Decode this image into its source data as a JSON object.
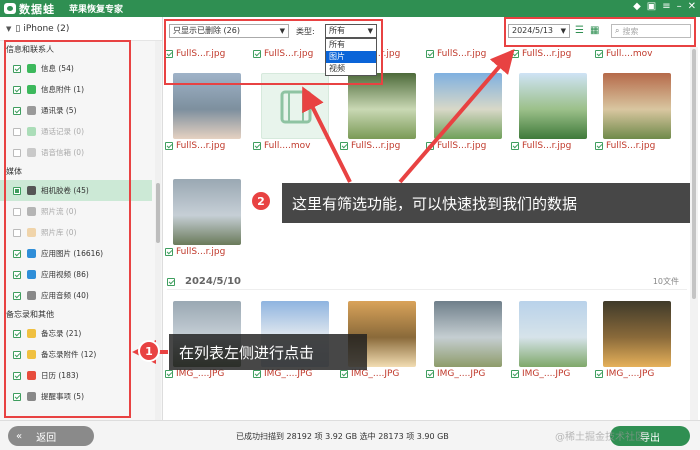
{
  "titlebar": {
    "logo_text": "数据蛙",
    "product_name": "苹果恢复专家"
  },
  "device": {
    "name": "iPhone (2)"
  },
  "sidebar": {
    "sections": [
      {
        "title": "信息和联系人",
        "items": [
          {
            "label": "信息 (54)",
            "state": "checked",
            "color": "#3cb85c"
          },
          {
            "label": "信息附件 (1)",
            "state": "checked",
            "color": "#3cb85c"
          },
          {
            "label": "通讯录 (5)",
            "state": "checked",
            "color": "#9a9a9a"
          },
          {
            "label": "通话记录 (0)",
            "state": "empty",
            "color": "#3cb85c"
          },
          {
            "label": "语音信箱 (0)",
            "state": "empty",
            "color": "#888888"
          }
        ]
      },
      {
        "title": "媒体",
        "items": [
          {
            "label": "相机胶卷 (45)",
            "state": "partial",
            "color": "#555555",
            "selected": true
          },
          {
            "label": "照片流 (0)",
            "state": "empty",
            "color": "#555555"
          },
          {
            "label": "照片库 (0)",
            "state": "empty",
            "color": "#e9a33a"
          },
          {
            "label": "应用图片 (16616)",
            "state": "checked",
            "color": "#2f8ed8"
          },
          {
            "label": "应用视频 (86)",
            "state": "checked",
            "color": "#2f8ed8"
          },
          {
            "label": "应用音频 (40)",
            "state": "checked",
            "color": "#888888"
          }
        ]
      },
      {
        "title": "备忘录和其他",
        "items": [
          {
            "label": "备忘录 (21)",
            "state": "checked",
            "color": "#f0c040"
          },
          {
            "label": "备忘录附件 (12)",
            "state": "checked",
            "color": "#f0c040"
          },
          {
            "label": "日历 (183)",
            "state": "checked",
            "color": "#e74c3c"
          },
          {
            "label": "提醒事项 (5)",
            "state": "checked",
            "color": "#888888"
          }
        ]
      }
    ]
  },
  "toolbar": {
    "filter_value": "只显示已删除 (26)",
    "type_label": "类型:",
    "type_value": "所有",
    "type_options": [
      "所有",
      "图片",
      "视频"
    ],
    "type_selected_index": 1,
    "date_value": "2024/5/13",
    "search_placeholder": "搜索"
  },
  "grid": {
    "row1_captions": [
      "FullS...r.jpg",
      "FullS...r.jpg",
      "FullS...r.jpg",
      "FullS...r.jpg",
      "FullS...r.jpg",
      "Full....mov"
    ],
    "row2_captions": [
      "FullS...r.jpg",
      "Full....mov",
      "FullS...r.jpg",
      "FullS...r.jpg",
      "FullS...r.jpg",
      "FullS...r.jpg"
    ],
    "row3_captions": [
      "FullS...r.jpg"
    ],
    "row4_captions": [
      "IMG_....JPG",
      "IMG_....JPG",
      "IMG_....JPG",
      "IMG_....JPG",
      "IMG_....JPG",
      "IMG_....JPG"
    ],
    "date_group": {
      "date": "2024/5/10",
      "count": "10文件"
    }
  },
  "status": {
    "text": "已成功扫描到 28192 项 3.92 GB  选中 28173 项 3.90 GB"
  },
  "buttons": {
    "back": "返回",
    "export": "导出"
  },
  "annotations": {
    "callout1": {
      "number": "1",
      "text": "在列表左侧进行点击"
    },
    "callout2": {
      "number": "2",
      "text": "这里有筛选功能，可以快速找到我们的数据"
    }
  },
  "watermark": "@稀土掘金技术社区",
  "colors": {
    "brand_green": "#2f8f52",
    "annotation_red": "#e84242",
    "deleted_caption": "#c0392b"
  }
}
